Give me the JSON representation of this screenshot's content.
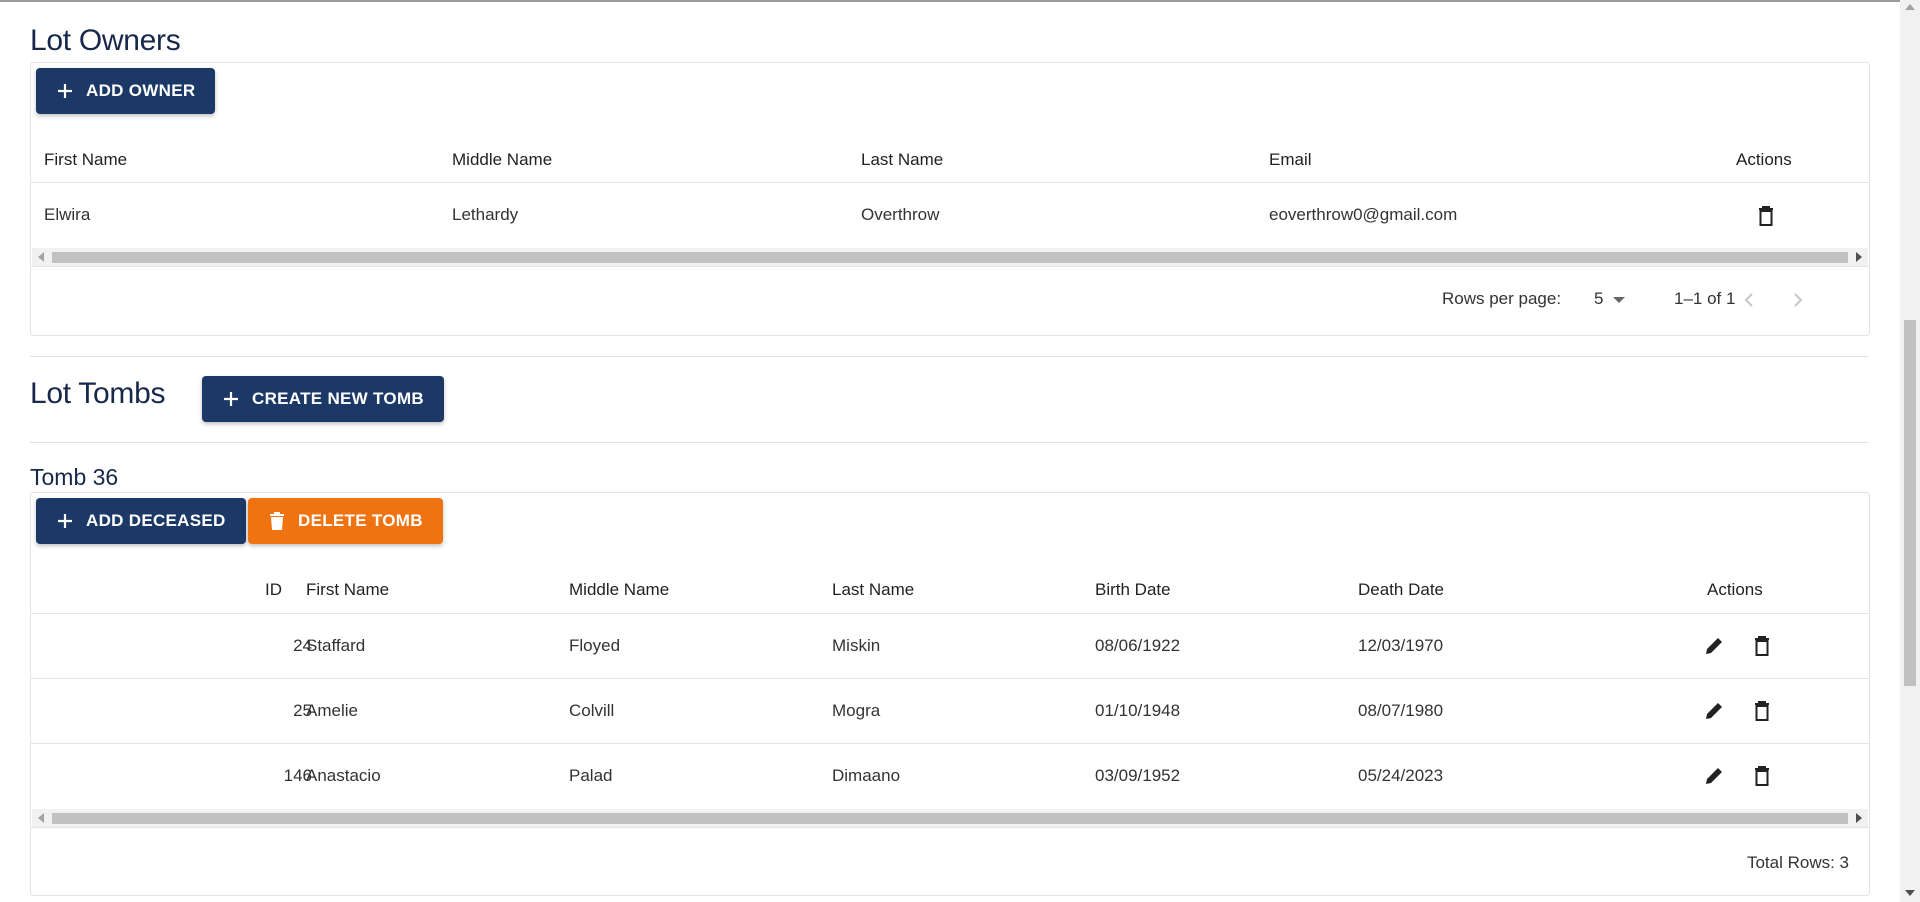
{
  "owners": {
    "title": "Lot Owners",
    "add_button": "ADD OWNER",
    "columns": [
      "First Name",
      "Middle Name",
      "Last Name",
      "Email",
      "Actions"
    ],
    "rows": [
      {
        "first": "Elwira",
        "middle": "Lethardy",
        "last": "Overthrow",
        "email": "eoverthrow0@gmail.com"
      }
    ],
    "pagination": {
      "rows_per_page_label": "Rows per page:",
      "rows_per_page_value": "5",
      "range": "1–1 of 1"
    }
  },
  "tombs": {
    "title": "Lot Tombs",
    "create_button": "CREATE NEW TOMB",
    "tomb": {
      "title": "Tomb 36",
      "add_button": "ADD DECEASED",
      "delete_button": "DELETE TOMB",
      "columns": [
        "ID",
        "First Name",
        "Middle Name",
        "Last Name",
        "Birth Date",
        "Death Date",
        "Actions"
      ],
      "rows": [
        {
          "id": "24",
          "first": "Staffard",
          "middle": "Floyed",
          "last": "Miskin",
          "birth": "08/06/1922",
          "death": "12/03/1970"
        },
        {
          "id": "25",
          "first": "Amelie",
          "middle": "Colvill",
          "last": "Mogra",
          "birth": "01/10/1948",
          "death": "08/07/1980"
        },
        {
          "id": "146",
          "first": "Anastacio",
          "middle": "Palad",
          "last": "Dimaano",
          "birth": "03/09/1952",
          "death": "05/24/2023"
        }
      ],
      "total_rows": "Total Rows: 3"
    }
  },
  "colors": {
    "navy": "#1b3866",
    "orange": "#ef7411",
    "title": "#17284a"
  },
  "icons": {
    "add": "plus-icon",
    "delete": "trash-icon",
    "edit": "pencil-icon",
    "prev": "chevron-left-icon",
    "next": "chevron-right-icon"
  }
}
